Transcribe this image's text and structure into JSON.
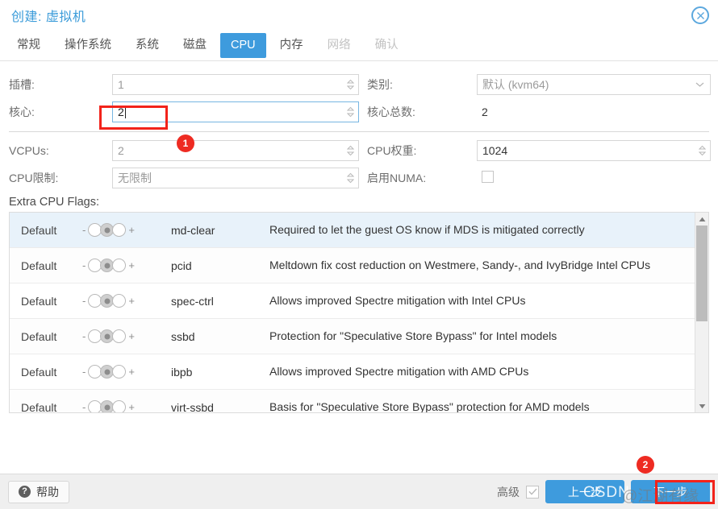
{
  "window": {
    "title": "创建: 虚拟机",
    "close_icon": "close-circle-icon"
  },
  "tabs": [
    {
      "label": "常规",
      "state": "normal"
    },
    {
      "label": "操作系统",
      "state": "normal"
    },
    {
      "label": "系统",
      "state": "normal"
    },
    {
      "label": "磁盘",
      "state": "normal"
    },
    {
      "label": "CPU",
      "state": "active"
    },
    {
      "label": "内存",
      "state": "normal"
    },
    {
      "label": "网络",
      "state": "disabled"
    },
    {
      "label": "确认",
      "state": "disabled"
    }
  ],
  "form": {
    "sockets": {
      "label": "插槽:",
      "value": "1"
    },
    "cores": {
      "label": "核心:",
      "value": "2"
    },
    "type": {
      "label": "类别:",
      "value": "默认 (kvm64)"
    },
    "total_cores": {
      "label": "核心总数:",
      "value": "2"
    },
    "vcpus": {
      "label": "VCPUs:",
      "value": "2"
    },
    "cpu_weight": {
      "label": "CPU权重:",
      "value": "1024"
    },
    "cpu_limit": {
      "label": "CPU限制:",
      "value": "无限制"
    },
    "enable_numa": {
      "label": "启用NUMA:",
      "checked": false
    }
  },
  "flags": {
    "title": "Extra CPU Flags:",
    "state_label": "Default",
    "minus": "-",
    "plus": "+",
    "rows": [
      {
        "state": "Default",
        "name": "md-clear",
        "desc": "Required to let the guest OS know if MDS is mitigated correctly"
      },
      {
        "state": "Default",
        "name": "pcid",
        "desc": "Meltdown fix cost reduction on Westmere, Sandy-, and IvyBridge Intel CPUs"
      },
      {
        "state": "Default",
        "name": "spec-ctrl",
        "desc": "Allows improved Spectre mitigation with Intel CPUs"
      },
      {
        "state": "Default",
        "name": "ssbd",
        "desc": "Protection for \"Speculative Store Bypass\" for Intel models"
      },
      {
        "state": "Default",
        "name": "ibpb",
        "desc": "Allows improved Spectre mitigation with AMD CPUs"
      },
      {
        "state": "Default",
        "name": "virt-ssbd",
        "desc": "Basis for \"Speculative Store Bypass\" protection for AMD models"
      }
    ]
  },
  "footer": {
    "help_label": "帮助",
    "advanced_label": "高级",
    "advanced_checked": true,
    "back_label": "上一步",
    "next_label": "下一步"
  },
  "annotations": {
    "badge1": "1",
    "badge2": "2"
  },
  "watermark": {
    "brand": "CSDN",
    "author": "@江湖有缘"
  },
  "colors": {
    "accent": "#3e9bdd",
    "title": "#3a9bd9",
    "annotation": "#f2231b",
    "row_highlight": "#e8f2fa"
  }
}
